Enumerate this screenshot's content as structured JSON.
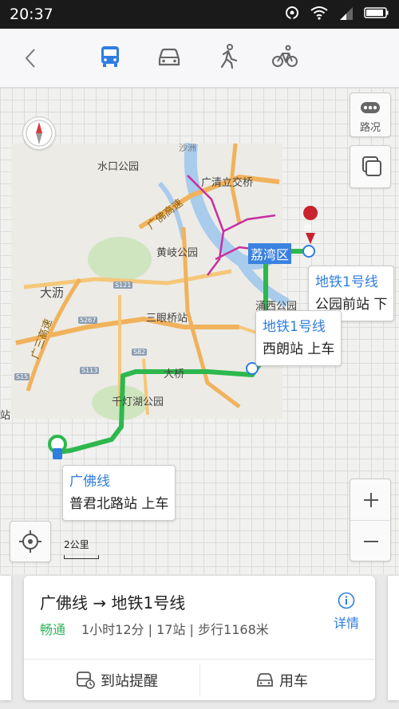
{
  "status_bar": {
    "time": "20:37"
  },
  "nav": {
    "back": "back-icon",
    "modes": [
      "bus",
      "car",
      "walk",
      "bike"
    ],
    "active_mode": "bus",
    "accent": "#2f7de1"
  },
  "map": {
    "traffic_label": "路况",
    "scale_label": "2公里",
    "district": "荔湾区",
    "end_marker": "终",
    "places": {
      "shuikou_park": "水口公园",
      "guangqing_bridge": "广清立交桥",
      "guangfo_highway": "广佛高速",
      "huangqi_park": "黄岐公园",
      "dali": "大沥",
      "sanyanqiao": "三眼桥站",
      "guangsan": "广三高速",
      "qiandeng_park": "千灯湖公园",
      "yonghe_park": "涌西公园",
      "daqiao": "大桥",
      "shazhou": "沙洲",
      "zhan": "站"
    },
    "road_signs": [
      "S121",
      "S267",
      "S82",
      "S113",
      "S15"
    ],
    "callouts": {
      "start": {
        "line": "广佛线",
        "stop": "普君北路站 上车"
      },
      "transfer": {
        "line": "地铁1号线",
        "stop": "西朗站 上车"
      },
      "end": {
        "line": "地铁1号线",
        "stop": "公园前站 下"
      }
    },
    "route_color": "#2db84d"
  },
  "card": {
    "title": "广佛线 → 地铁1号线",
    "status": "畅通",
    "info": "1小时12分 | 17站 | 步行1168米",
    "detail": "详情",
    "arrival_alert": "到站提醒",
    "use_car": "用车"
  }
}
